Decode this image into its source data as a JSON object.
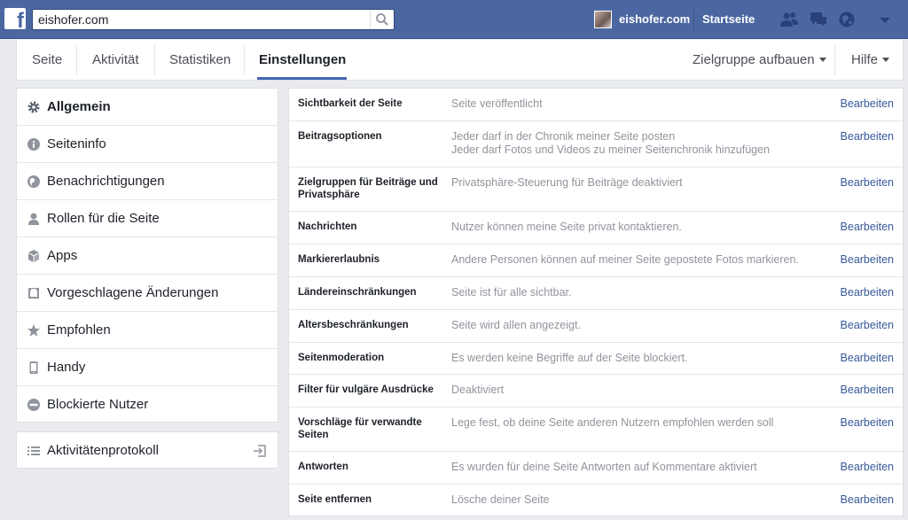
{
  "topbar": {
    "search_value": "eishofer.com",
    "profile_name": "eishofer.com",
    "home_label": "Startseite",
    "icons": [
      "friends-icon",
      "messages-icon",
      "notifications-icon",
      "account-menu-icon"
    ]
  },
  "tabs": {
    "items": [
      "Seite",
      "Aktivität",
      "Statistiken",
      "Einstellungen"
    ],
    "active": "Einstellungen",
    "audience": "Zielgruppe aufbauen",
    "help": "Hilfe"
  },
  "sidebar": {
    "items": [
      {
        "label": "Allgemein",
        "icon": "gear-icon",
        "active": true
      },
      {
        "label": "Seiteninfo",
        "icon": "info-icon"
      },
      {
        "label": "Benachrichtigungen",
        "icon": "globe-icon"
      },
      {
        "label": "Rollen für die Seite",
        "icon": "person-icon"
      },
      {
        "label": "Apps",
        "icon": "cube-icon"
      },
      {
        "label": "Vorgeschlagene Änderungen",
        "icon": "edit-box-icon"
      },
      {
        "label": "Empfohlen",
        "icon": "star-icon"
      },
      {
        "label": "Handy",
        "icon": "phone-icon"
      },
      {
        "label": "Blockierte Nutzer",
        "icon": "blocked-icon"
      }
    ],
    "activity_log": "Aktivitätenprotokoll"
  },
  "settings": {
    "edit_label": "Bearbeiten",
    "rows": [
      {
        "name": "Sichtbarkeit der Seite",
        "value": "Seite veröffentlicht"
      },
      {
        "name": "Beitragsoptionen",
        "value": "Jeder darf in der Chronik meiner Seite posten",
        "value2": "Jeder darf Fotos und Videos zu meiner Seitenchronik hinzufügen"
      },
      {
        "name": "Zielgruppen für Beiträge und Privatsphäre",
        "value": "Privatsphäre-Steuerung für Beiträge deaktiviert"
      },
      {
        "name": "Nachrichten",
        "value": "Nutzer können meine Seite privat kontaktieren."
      },
      {
        "name": "Markiererlaubnis",
        "value": "Andere Personen können auf meiner Seite gepostete Fotos markieren."
      },
      {
        "name": "Ländereinschränkungen",
        "value": "Seite ist für alle sichtbar."
      },
      {
        "name": "Altersbeschränkungen",
        "value": "Seite wird allen angezeigt."
      },
      {
        "name": "Seitenmoderation",
        "value": "Es werden keine Begriffe auf der Seite blockiert."
      },
      {
        "name": "Filter für vulgäre Ausdrücke",
        "value": "Deaktiviert"
      },
      {
        "name": "Vorschläge für verwandte Seiten",
        "value": "Lege fest, ob deine Seite anderen Nutzern empfohlen werden soll"
      },
      {
        "name": "Antworten",
        "value": "Es wurden für deine Seite Antworten auf Kommentare aktiviert"
      },
      {
        "name": "Seite entfernen",
        "value": "Lösche deiner Seite"
      }
    ]
  },
  "colors": {
    "topbar": "#4b67a1",
    "link": "#365899",
    "tab_active": "#4267b2",
    "muted_text": "#90949c"
  }
}
